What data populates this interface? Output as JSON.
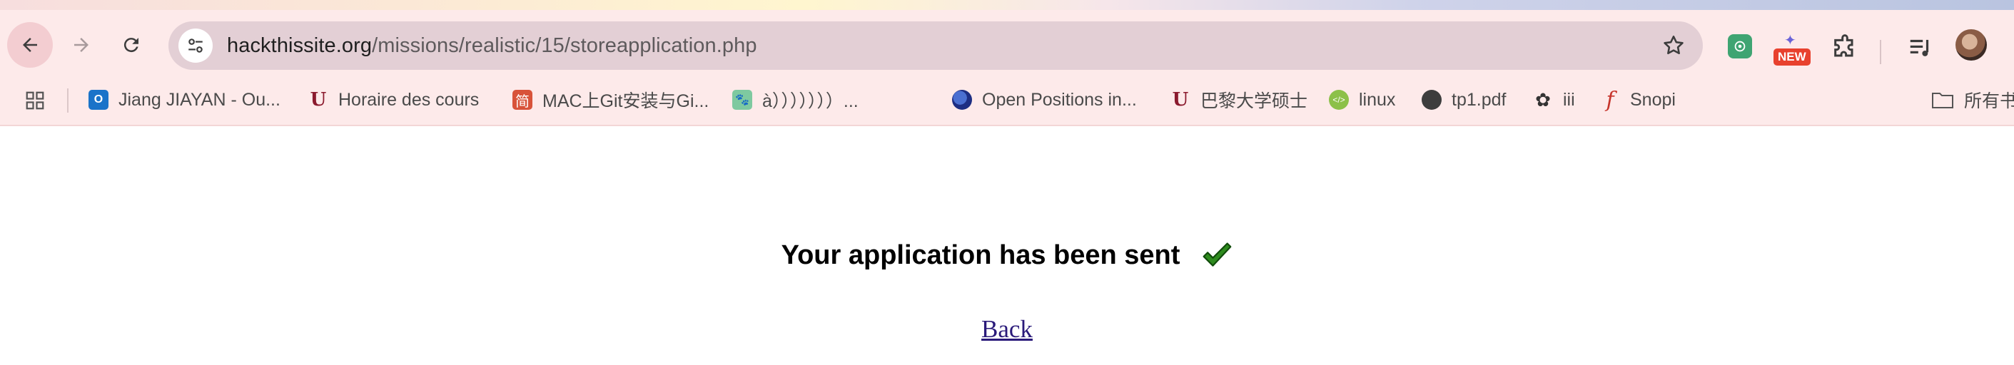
{
  "browser": {
    "url_host": "hackthissite.org",
    "url_path": "/missions/realistic/15/storeapplication.php",
    "extensions": {
      "new_badge": "NEW"
    }
  },
  "bookmarks": [
    {
      "label": "Jiang JIAYAN - Ou...",
      "icon": "outlook-icon",
      "icon_text": "O"
    },
    {
      "label": "Horaire des cours",
      "icon": "universite-paris-icon",
      "icon_text": "U"
    },
    {
      "label": "MAC上Git安装与Gi...",
      "icon": "jian-icon",
      "icon_text": "简"
    },
    {
      "label": "à）））））））...",
      "icon": "paw-icon",
      "icon_text": "🐾"
    },
    {
      "label": "Open Positions in...",
      "icon": "globe-icon",
      "icon_text": ""
    },
    {
      "label": "巴黎大学硕士",
      "icon": "universite-paris-icon",
      "icon_text": "U"
    },
    {
      "label": "linux",
      "icon": "linux-icon",
      "icon_text": "</>"
    },
    {
      "label": "tp1.pdf",
      "icon": "world-icon",
      "icon_text": ""
    },
    {
      "label": "iii",
      "icon": "openai-icon",
      "icon_text": "✿"
    },
    {
      "label": "Snopi",
      "icon": "flash-icon",
      "icon_text": "f"
    }
  ],
  "bookmarks_folder": {
    "label": "所有书"
  },
  "page": {
    "message": "Your application has been sent",
    "back_link": "Back"
  }
}
